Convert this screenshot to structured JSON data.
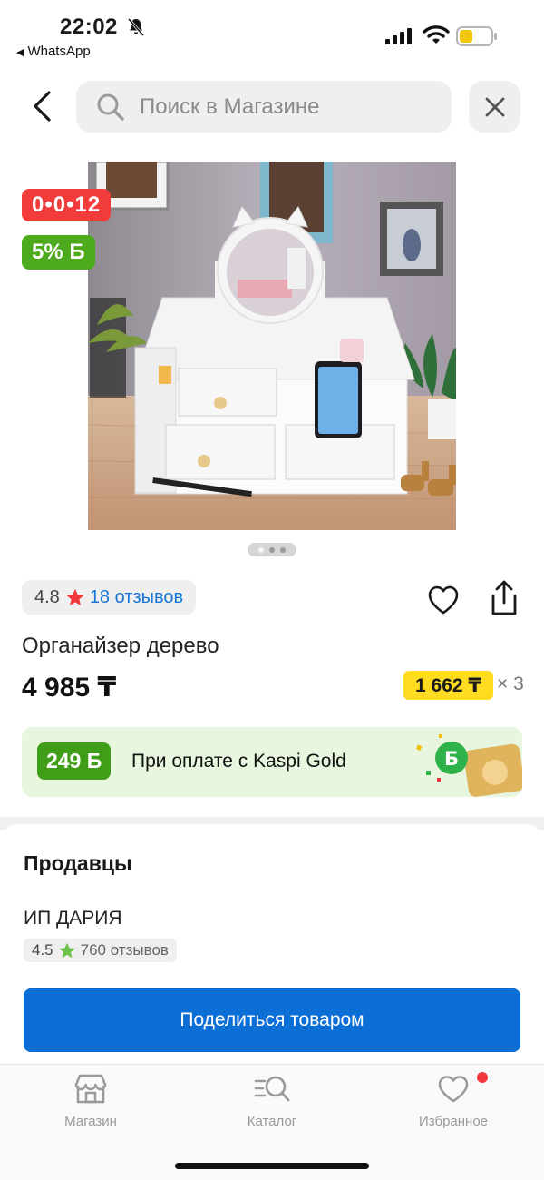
{
  "status_bar": {
    "time": "22:02",
    "back_app": "WhatsApp"
  },
  "search": {
    "placeholder": "Поиск в Магазине"
  },
  "badges": {
    "timer": "0•0•12",
    "bonus": "5% Б"
  },
  "rating": {
    "value": "4.8",
    "reviews": "18 отзывов"
  },
  "product": {
    "title": "Органайзер дерево",
    "price": "4 985 ₸",
    "installment": "1 662 ₸",
    "installment_multiplier": "× 3"
  },
  "kaspi_banner": {
    "bonus": "249 Б",
    "text": "При оплате с Kaspi Gold"
  },
  "sellers": {
    "title": "Продавцы",
    "name": "ИП ДАРИЯ",
    "rating": "4.5",
    "reviews": "760 отзывов"
  },
  "share_button": "Поделиться товаром",
  "bottom_nav": {
    "shop": "Магазин",
    "catalog": "Каталог",
    "favorites": "Избранное"
  },
  "colors": {
    "accent_blue": "#0b6fd6",
    "timer_red": "#f23b3b",
    "bonus_green": "#4caa1c",
    "installment_yellow": "#ffdc1f",
    "notification_red": "#f0373b"
  },
  "image_carousel": {
    "pages": 3,
    "active_page": 1
  }
}
